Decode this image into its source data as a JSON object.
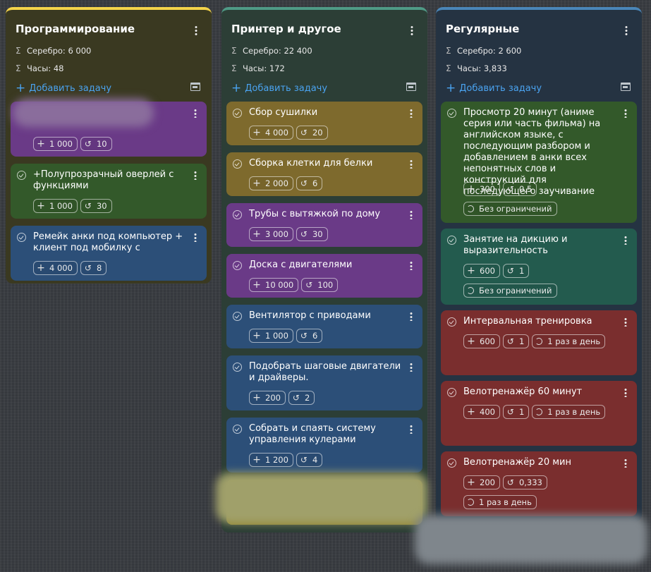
{
  "columns": [
    {
      "title": "Программирование",
      "accent": "#f3d34a",
      "stat_silver": "Серебро: 6 000",
      "stat_hours": "Часы: 48",
      "add_task": "Добавить задачу",
      "cards": [
        {
          "title": "",
          "reward": "1 000",
          "repeats": "10",
          "color": "purple",
          "redacted": true
        },
        {
          "title": "+Полупрозрачный оверлей с функциями",
          "reward": "1 000",
          "repeats": "30",
          "color": "green"
        },
        {
          "title": "Ремейк анки под компьютер + клиент под мобилку с",
          "reward": "4 000",
          "repeats": "8",
          "color": "blue"
        }
      ]
    },
    {
      "title": "Принтер и другое",
      "accent": "#4f9a86",
      "stat_silver": "Серебро: 22 400",
      "stat_hours": "Часы: 172",
      "add_task": "Добавить задачу",
      "cards": [
        {
          "title": "Сбор сушилки",
          "reward": "4 000",
          "repeats": "20",
          "color": "olive"
        },
        {
          "title": "Сборка клетки для белки",
          "reward": "2 000",
          "repeats": "6",
          "color": "olive"
        },
        {
          "title": "Трубы с вытяжкой по дому",
          "reward": "3 000",
          "repeats": "30",
          "color": "purple"
        },
        {
          "title": "Доска с двигателями",
          "reward": "10 000",
          "repeats": "100",
          "color": "purple"
        },
        {
          "title": "Вентилятор с приводами",
          "reward": "1 000",
          "repeats": "6",
          "color": "blue"
        },
        {
          "title": "Подобрать шаговые двигатели и драйверы.",
          "reward": "200",
          "repeats": "2",
          "color": "blue"
        },
        {
          "title": "Собрать и спаять систему управления кулерами",
          "reward": "1 200",
          "repeats": "4",
          "color": "blue"
        },
        {
          "title": "",
          "reward": "",
          "repeats": "",
          "color": "yellow",
          "redacted": true
        }
      ]
    },
    {
      "title": "Регулярные",
      "accent": "#4a86b8",
      "stat_silver": "Серебро: 2 600",
      "stat_hours": "Часы: 3,833",
      "add_task": "Добавить задачу",
      "cards": [
        {
          "title": "Просмотр 20 минут (аниме серия или часть фильма) на английском языке, с последующим разбором и добавлением в анки всех непонятных слов и конструкций для последующего заучивание",
          "reward": "300",
          "repeats": "0,5",
          "schedule": "Без ограничений",
          "color": "green"
        },
        {
          "title": "Занятие на дикцию и выразительность",
          "reward": "600",
          "repeats": "1",
          "schedule": "Без ограничений",
          "color": "teal"
        },
        {
          "title": "Интервальная тренировка",
          "reward": "600",
          "repeats": "1",
          "schedule": "1 раз в день",
          "color": "red"
        },
        {
          "title": "Велотренажёр 60 минут",
          "reward": "400",
          "repeats": "1",
          "schedule": "1 раз в день",
          "color": "red"
        },
        {
          "title": "Велотренажёр 20 мин",
          "reward": "200",
          "repeats": "0,333",
          "schedule": "1 раз в день",
          "color": "red"
        }
      ]
    }
  ],
  "icons": {
    "sum": "sigma-icon",
    "add": "plus-icon",
    "repeat": "history-icon",
    "schedule": "refresh-icon",
    "check": "check-circle-icon",
    "menu": "kebab-menu-icon"
  }
}
